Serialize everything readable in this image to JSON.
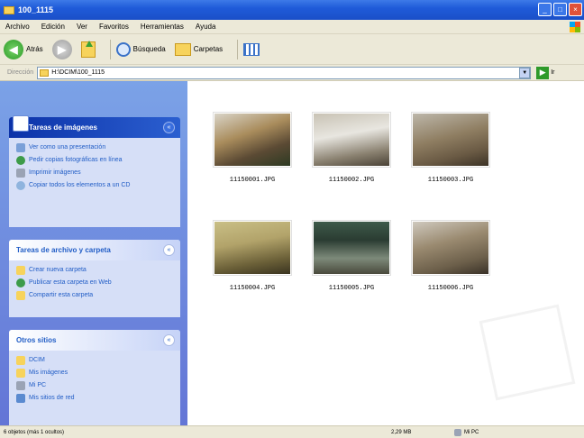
{
  "window": {
    "title": "100_1115",
    "buttons": {
      "min": "_",
      "max": "□",
      "close": "×"
    }
  },
  "menu": [
    "Archivo",
    "Edición",
    "Ver",
    "Favoritos",
    "Herramientas",
    "Ayuda"
  ],
  "toolbar": {
    "back": "Atrás",
    "back_glyph": "◀",
    "forward_glyph": "▶",
    "search": "Búsqueda",
    "folders": "Carpetas"
  },
  "address": {
    "label": "Dirección",
    "value": "H:\\DCIM\\100_1115",
    "go": "Ir",
    "dropdown": "▼",
    "go_glyph": "▶"
  },
  "sidebar": {
    "chevron": "«",
    "panels": [
      {
        "title": "Tareas de imágenes",
        "items": [
          "Ver como una presentación",
          "Pedir copias fotográficas en línea",
          "Imprimir imágenes",
          "Copiar todos los elementos a un CD"
        ]
      },
      {
        "title": "Tareas de archivo y carpeta",
        "items": [
          "Crear nueva carpeta",
          "Publicar esta carpeta en Web",
          "Compartir esta carpeta"
        ]
      },
      {
        "title": "Otros sitios",
        "items": [
          "DCIM",
          "Mis imágenes",
          "Mi PC",
          "Mis sitios de red"
        ]
      }
    ]
  },
  "files": [
    {
      "name": "11150001.JPG"
    },
    {
      "name": "11150002.JPG"
    },
    {
      "name": "11150003.JPG"
    },
    {
      "name": "11150004.JPG"
    },
    {
      "name": "11150005.JPG"
    },
    {
      "name": "11150006.JPG"
    }
  ],
  "status": {
    "objects": "6 objetos (más 1 ocultos)",
    "size": "2,29 MB",
    "location": "Mi PC"
  },
  "colors": {
    "titlebar": "#1f5bd9",
    "sidebar_bg": "#6f8ce0",
    "panel_bg": "#d6dff7",
    "link": "#215dc6"
  }
}
